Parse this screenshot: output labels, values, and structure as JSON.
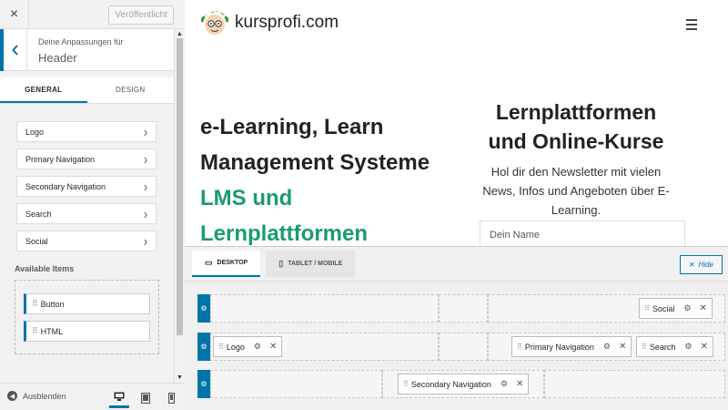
{
  "topbar": {
    "close_icon": "×",
    "publish_label": "Veröffentlicht"
  },
  "section": {
    "subtitle": "Deine Anpassungen für",
    "title": "Header"
  },
  "tabs": [
    {
      "label": "GENERAL",
      "active": true
    },
    {
      "label": "DESIGN",
      "active": false
    }
  ],
  "items": [
    {
      "label": "Logo"
    },
    {
      "label": "Primary Navigation"
    },
    {
      "label": "Secondary Navigation"
    },
    {
      "label": "Search"
    },
    {
      "label": "Social"
    }
  ],
  "available": {
    "label": "Available Items",
    "items": [
      {
        "label": "Button"
      },
      {
        "label": "HTML"
      }
    ]
  },
  "footer": {
    "hide_label": "Ausblenden",
    "devices": [
      "desktop-icon",
      "tablet-icon",
      "mobile-icon"
    ],
    "active_device": "desktop"
  },
  "preview": {
    "logo_text": "kursprofi.com",
    "hero_lines": [
      "e-Learning, Learn",
      "Management Systeme"
    ],
    "hero_green": [
      "LMS und",
      "Lernplattformen"
    ],
    "side_title": "Lernplattformen und Online-Kurse",
    "side_text": "Hol dir den Newsletter mit vielen News, Infos und Angeboten über E-Learning.",
    "input_placeholder": "Dein Name",
    "colors": {
      "accent": "#0073aa",
      "green": "#1a9c6d"
    }
  },
  "builder": {
    "tabs": [
      {
        "label": "DESKTOP",
        "icon": "desktop-icon",
        "active": true
      },
      {
        "label": "TABLET / MOBILE",
        "icon": "tablet-icon",
        "active": false
      }
    ],
    "hide_label": "Hide",
    "rows": [
      {
        "name": "top",
        "chips": [
          {
            "label": "Social"
          }
        ]
      },
      {
        "name": "main",
        "chips": [
          {
            "label": "Logo"
          },
          {
            "label": "Primary Navigation"
          },
          {
            "label": "Search"
          }
        ]
      },
      {
        "name": "bottom",
        "chips": [
          {
            "label": "Secondary Navigation"
          }
        ]
      }
    ]
  }
}
